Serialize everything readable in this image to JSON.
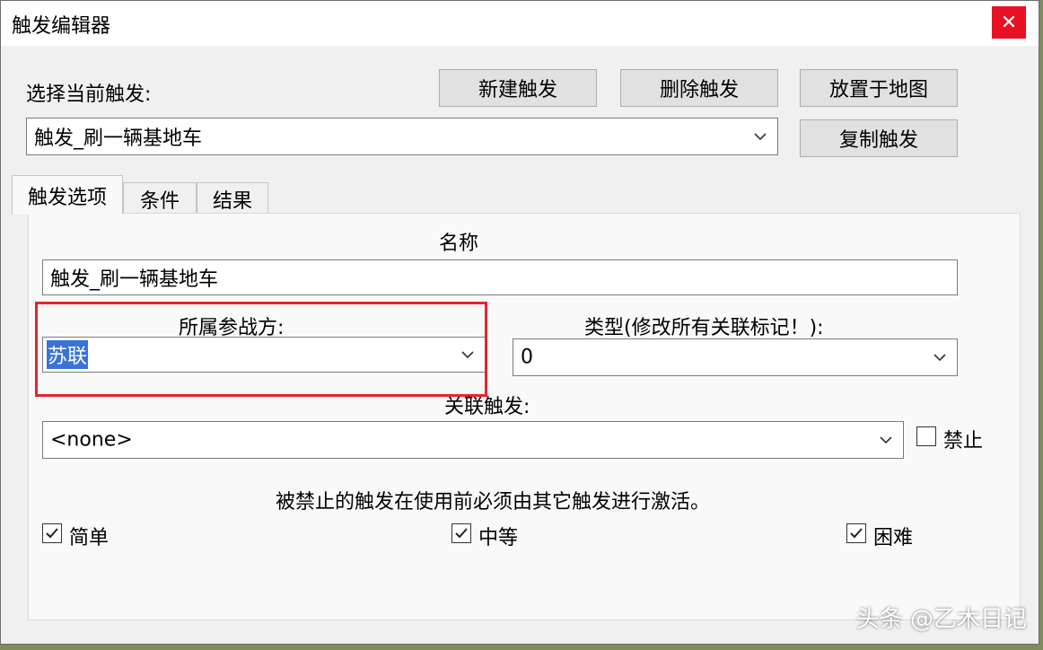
{
  "window": {
    "title": "触发编辑器",
    "close_glyph": "✕",
    "close_color": "#e81123"
  },
  "top": {
    "select_label": "选择当前触发:",
    "buttons": {
      "new": "新建触发",
      "delete": "删除触发",
      "place": "放置于地图",
      "copy": "复制触发"
    },
    "current_trigger": "触发_刷一辆基地车"
  },
  "tabs": [
    {
      "label": "触发选项",
      "active": true
    },
    {
      "label": "条件",
      "active": false
    },
    {
      "label": "结果",
      "active": false
    }
  ],
  "options": {
    "name_label": "名称",
    "name_value": "触发_刷一辆基地车",
    "side_label": "所属参战方:",
    "side_value": "苏联",
    "type_label": "类型(修改所有关联标记！):",
    "type_value": "0",
    "linked_label": "关联触发:",
    "linked_value": "<none>",
    "disabled_label": "禁止",
    "disabled_checked": false,
    "note": "被禁止的触发在使用前必须由其它触发进行激活。",
    "difficulty": [
      {
        "label": "简单",
        "checked": true
      },
      {
        "label": "中等",
        "checked": true
      },
      {
        "label": "困难",
        "checked": true
      }
    ]
  },
  "watermark": "头条 @乙木日记",
  "colors": {
    "highlight": "#e3262b",
    "selection": "#3874d8"
  }
}
